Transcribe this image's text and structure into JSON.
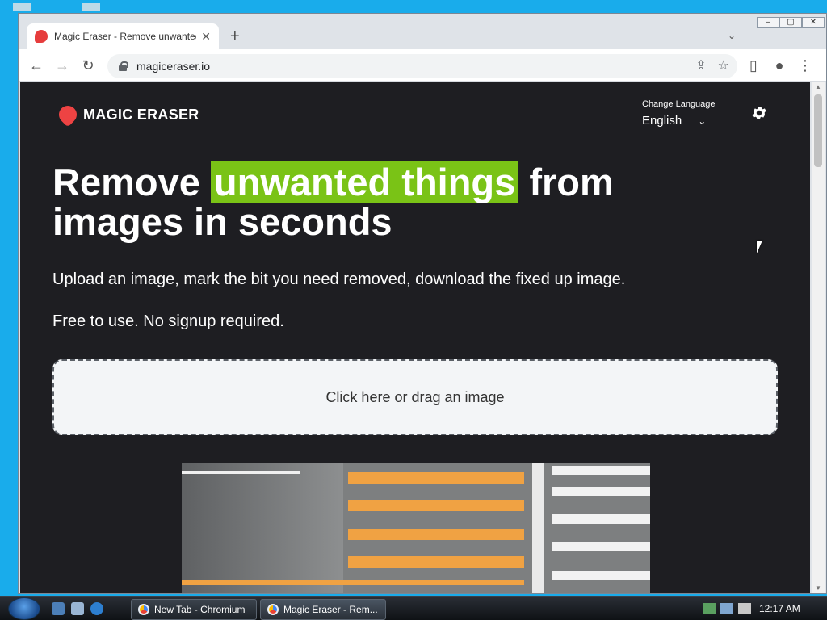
{
  "browser": {
    "tab_title": "Magic Eraser - Remove unwanted",
    "tab_close": "✕",
    "new_tab": "+",
    "url": "magiceraser.io"
  },
  "site": {
    "logo_text": "MAGIC ERASER",
    "language_label": "Change Language",
    "language_value": "English",
    "headline_pre": "Remove ",
    "headline_highlight": "unwanted things",
    "headline_post": " from images in seconds",
    "subtext_1": "Upload an image, mark the bit you need removed, download the fixed up image.",
    "subtext_2": "Free to use. No signup required.",
    "dropzone_text": "Click here or drag an image"
  },
  "taskbar": {
    "items": [
      {
        "label": "New Tab - Chromium"
      },
      {
        "label": "Magic Eraser - Rem..."
      }
    ],
    "clock": "12:17 AM"
  },
  "icons": [
    "favicon-icon",
    "back-icon",
    "forward-icon",
    "reload-icon",
    "lock-icon",
    "share-icon",
    "star-icon",
    "sidepanel-icon",
    "profile-icon",
    "menu-icon",
    "gear-icon",
    "chevron-down-icon"
  ],
  "colors": {
    "highlight": "#7ac316",
    "page_bg": "#1e1e22",
    "logo_red": "#ee4343"
  }
}
